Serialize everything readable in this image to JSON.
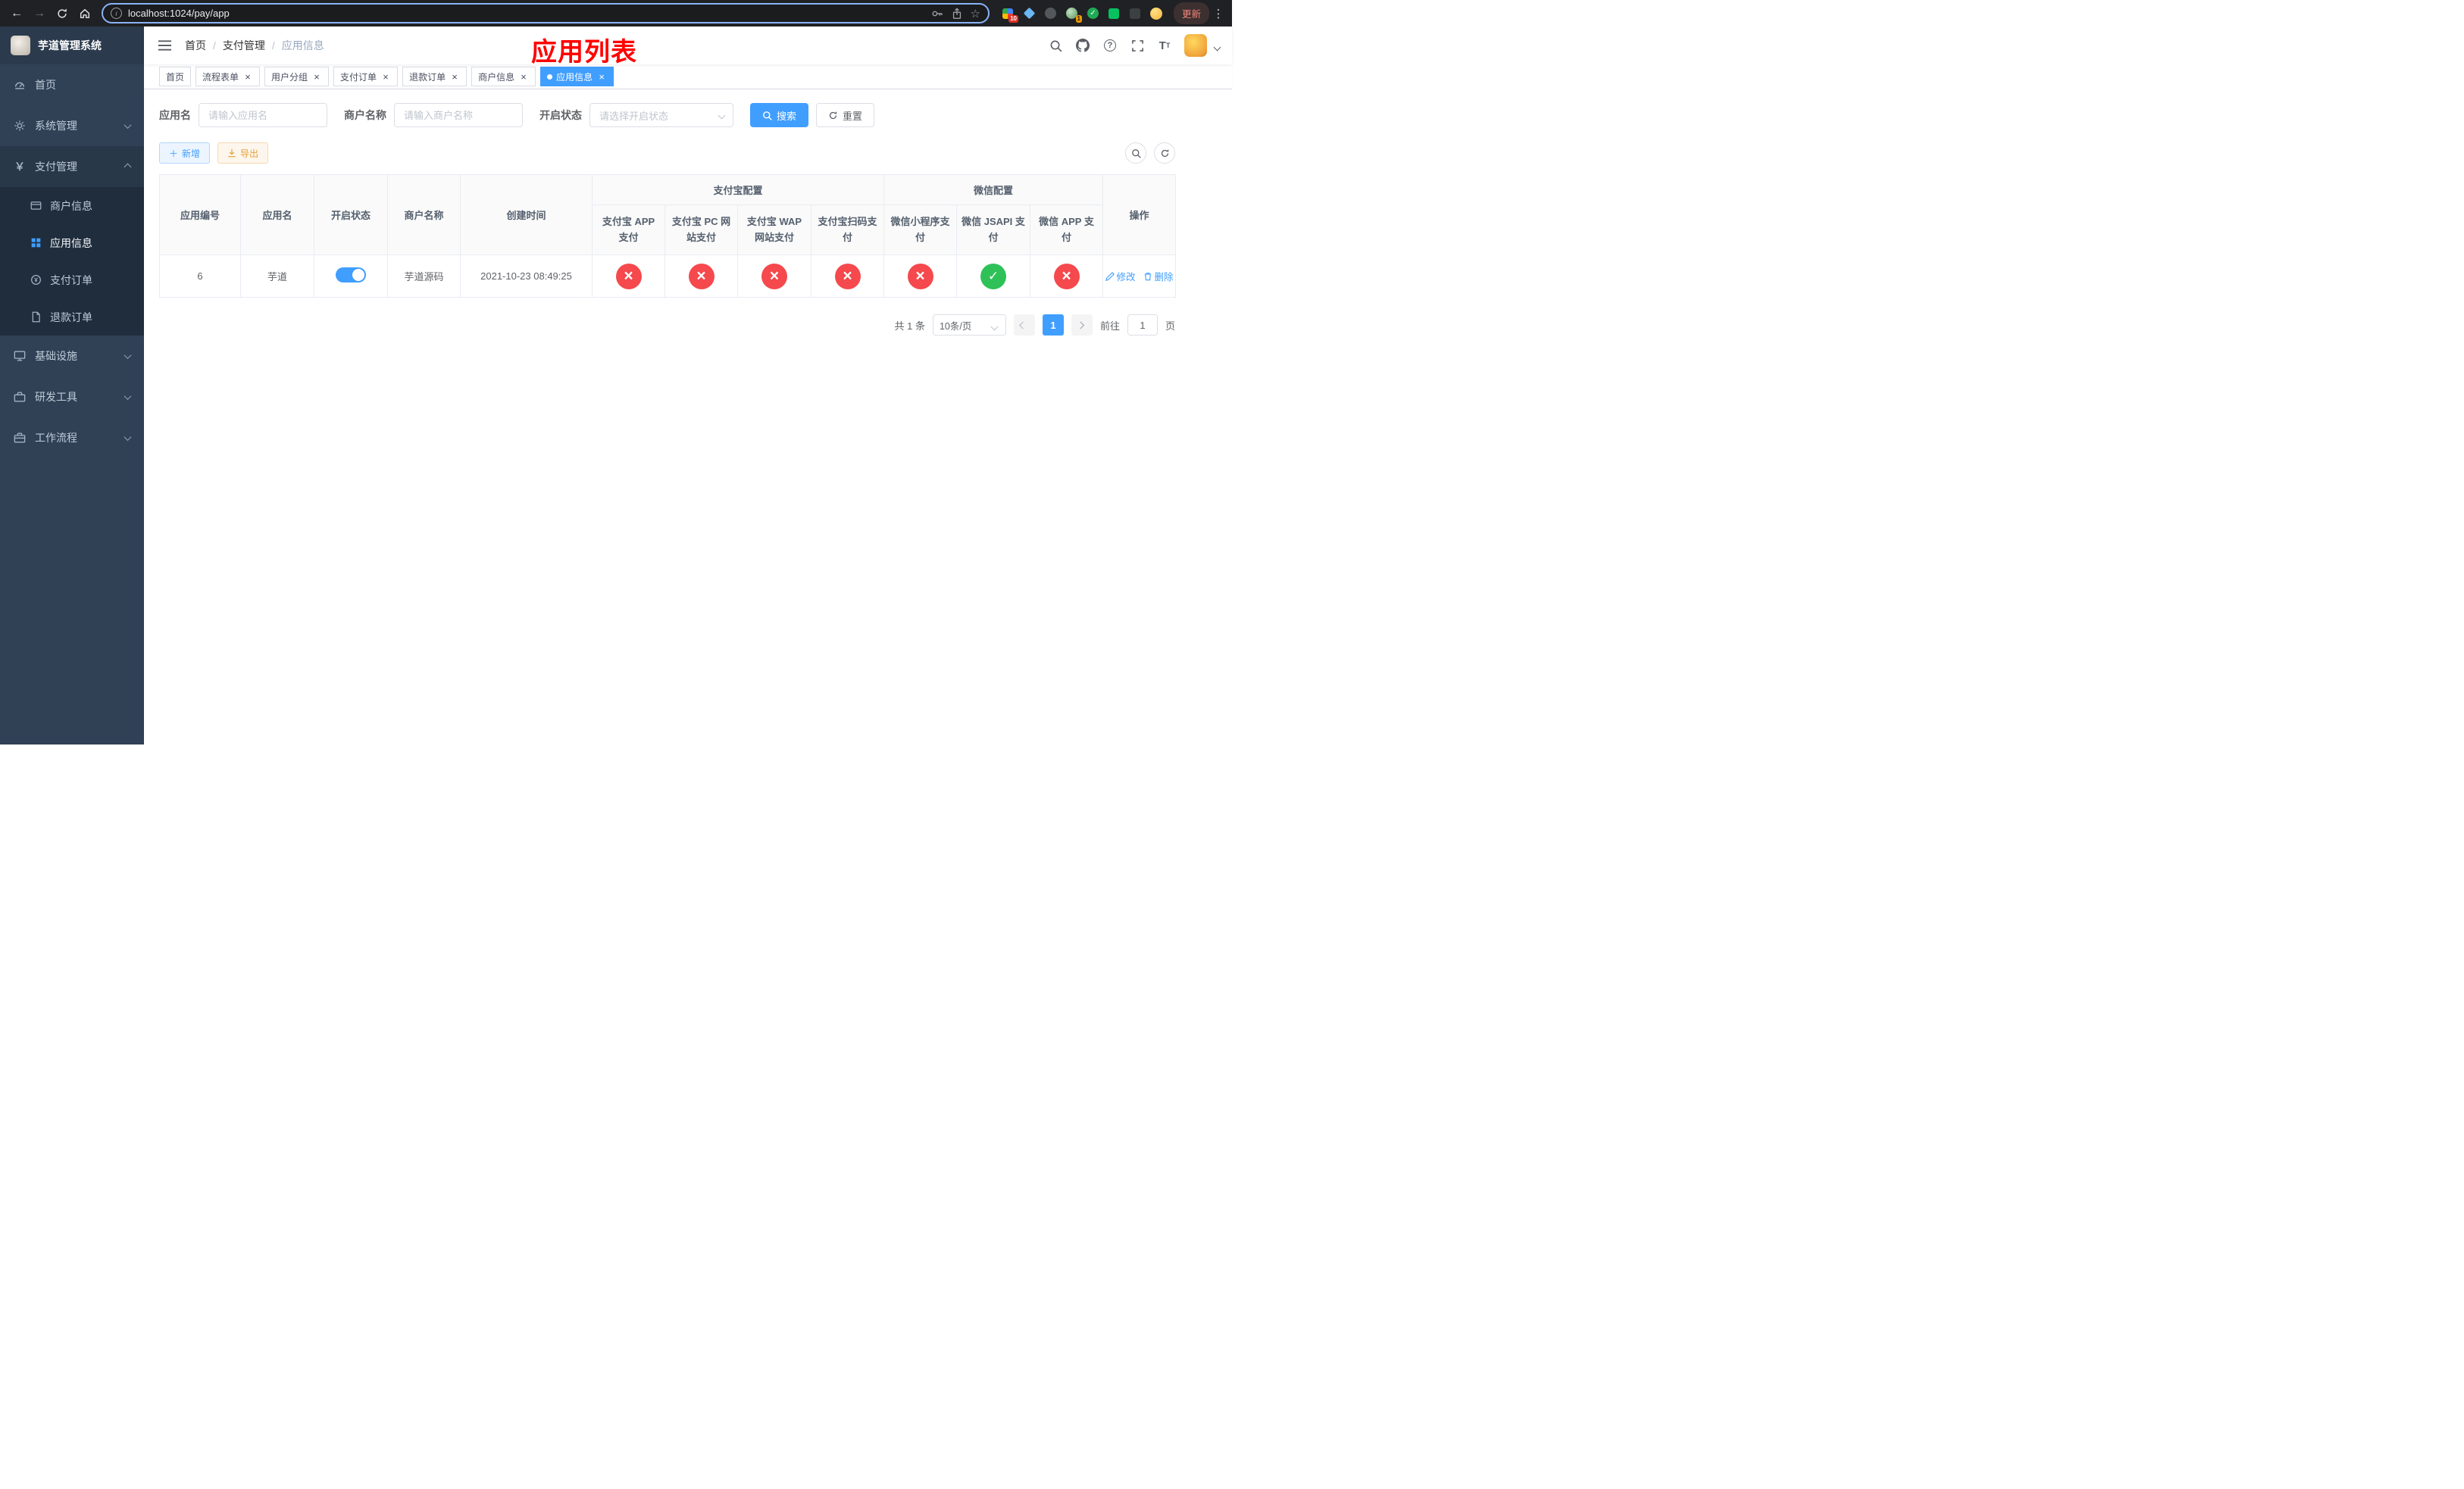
{
  "browser": {
    "url": "localhost:1024/pay/app",
    "update_label": "更新",
    "extensions_badge": "10",
    "avatar_badge": "1"
  },
  "app": {
    "title": "芋道管理系统"
  },
  "sidebar": {
    "items": [
      {
        "label": "首页"
      },
      {
        "label": "系统管理"
      },
      {
        "label": "支付管理",
        "expanded": true,
        "children": [
          {
            "label": "商户信息",
            "active": false
          },
          {
            "label": "应用信息",
            "active": true
          },
          {
            "label": "支付订单",
            "active": false
          },
          {
            "label": "退款订单",
            "active": false
          }
        ]
      },
      {
        "label": "基础设施"
      },
      {
        "label": "研发工具"
      },
      {
        "label": "工作流程"
      }
    ]
  },
  "header": {
    "breadcrumb": {
      "home": "首页",
      "section": "支付管理",
      "current": "应用信息"
    },
    "overlay_title": "应用列表"
  },
  "tabs": [
    {
      "label": "首页",
      "closable": false,
      "active": false
    },
    {
      "label": "流程表单",
      "closable": true,
      "active": false
    },
    {
      "label": "用户分组",
      "closable": true,
      "active": false
    },
    {
      "label": "支付订单",
      "closable": true,
      "active": false
    },
    {
      "label": "退款订单",
      "closable": true,
      "active": false
    },
    {
      "label": "商户信息",
      "closable": true,
      "active": false
    },
    {
      "label": "应用信息",
      "closable": true,
      "active": true
    }
  ],
  "filters": {
    "app_name": {
      "label": "应用名",
      "placeholder": "请输入应用名",
      "value": ""
    },
    "merchant_name": {
      "label": "商户名称",
      "placeholder": "请输入商户名称",
      "value": ""
    },
    "status": {
      "label": "开启状态",
      "placeholder": "请选择开启状态",
      "value": ""
    },
    "search_label": "搜索",
    "reset_label": "重置"
  },
  "toolbar": {
    "add_label": "新增",
    "export_label": "导出"
  },
  "table": {
    "headers": {
      "app_id": "应用编号",
      "app_name": "应用名",
      "status": "开启状态",
      "merchant": "商户名称",
      "created": "创建时间",
      "alipay_group": "支付宝配置",
      "wechat_group": "微信配置",
      "alipay_app": "支付宝 APP 支付",
      "alipay_pc": "支付宝 PC 网站支付",
      "alipay_wap": "支付宝 WAP 网站支付",
      "alipay_qr": "支付宝扫码支付",
      "wx_lite": "微信小程序支付",
      "wx_jsapi": "微信 JSAPI 支付",
      "wx_app": "微信 APP 支付",
      "actions": "操作"
    },
    "rows": [
      {
        "app_id": "6",
        "app_name": "芋道",
        "enabled": true,
        "merchant": "芋道源码",
        "created": "2021-10-23 08:49:25",
        "alipay_app": false,
        "alipay_pc": false,
        "alipay_wap": false,
        "alipay_qr": false,
        "wx_lite": false,
        "wx_jsapi": true,
        "wx_app": false,
        "edit_label": "修改",
        "delete_label": "删除"
      }
    ]
  },
  "pagination": {
    "total": "共 1 条",
    "page_size": "10条/页",
    "page": "1",
    "goto_label": "前往",
    "goto_value": "1",
    "goto_suffix": "页"
  },
  "colors": {
    "primary": "#409eff",
    "danger": "#f5494d",
    "success": "#2ec158",
    "warning": "#e6a23c",
    "sidebar_bg": "#304156",
    "sidebar_submenu_bg": "#1f2d3d",
    "annotation_red": "#ff0000"
  }
}
